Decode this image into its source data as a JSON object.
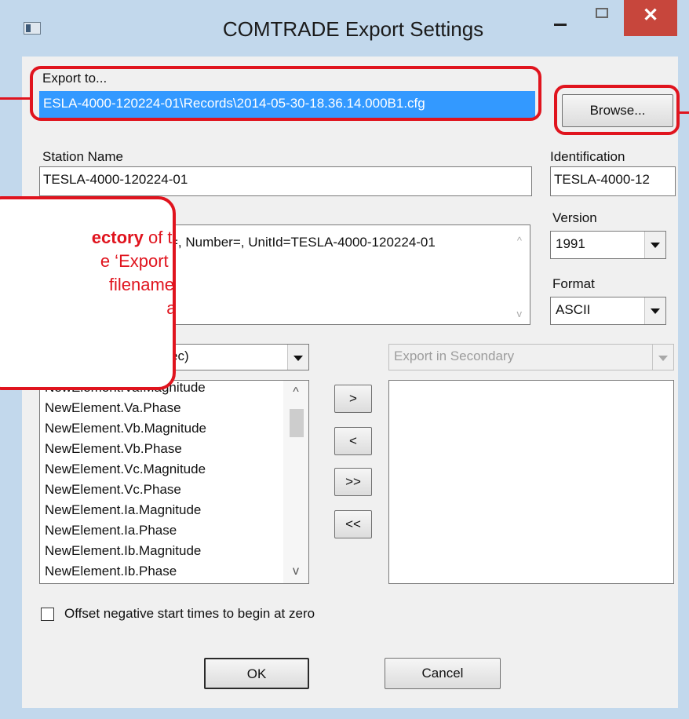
{
  "window": {
    "title": "COMTRADE Export Settings",
    "close_glyph": "✕",
    "icons": {
      "app": "app-window-icon",
      "minimize": "minimize-icon",
      "maximize": "maximize-icon",
      "close": "close-icon"
    }
  },
  "export": {
    "label": "Export to...",
    "path": "ESLA-4000-120224-01\\Records\\2014-05-30-18.36.14.000B1.cfg",
    "browse_label": "Browse..."
  },
  "station": {
    "label": "Station Name",
    "value": "TESLA-4000-120224-01"
  },
  "identification": {
    "label": "Identification",
    "value": "TESLA-4000-12"
  },
  "info_text": "=, Number=, UnitId=TESLA-4000-120224-01",
  "version": {
    "label": "Version",
    "value": "1991"
  },
  "format": {
    "label": "Format",
    "value": "ASCII"
  },
  "left_combo": {
    "value": "ec)"
  },
  "right_combo": {
    "value": "Export in Secondary"
  },
  "channels": [
    "NewElement.Va.Magnitude",
    "NewElement.Va.Phase",
    "NewElement.Vb.Magnitude",
    "NewElement.Vb.Phase",
    "NewElement.Vc.Magnitude",
    "NewElement.Vc.Phase",
    "NewElement.Ia.Magnitude",
    "NewElement.Ia.Phase",
    "NewElement.Ib.Magnitude",
    "NewElement.Ib.Phase"
  ],
  "transfer_buttons": {
    "add": ">",
    "remove": "<",
    "add_all": ">>",
    "remove_all": "<<"
  },
  "offset_checkbox": {
    "label": "Offset negative start times to begin at zero",
    "checked": false
  },
  "buttons": {
    "ok": "OK",
    "cancel": "Cancel"
  },
  "callout": {
    "bold": "ectory",
    "line1_rest": " of the",
    "line2": "e ‘Export to’",
    "line3": "filename is",
    "line4": "are"
  },
  "annotation_color": "#e0141e"
}
